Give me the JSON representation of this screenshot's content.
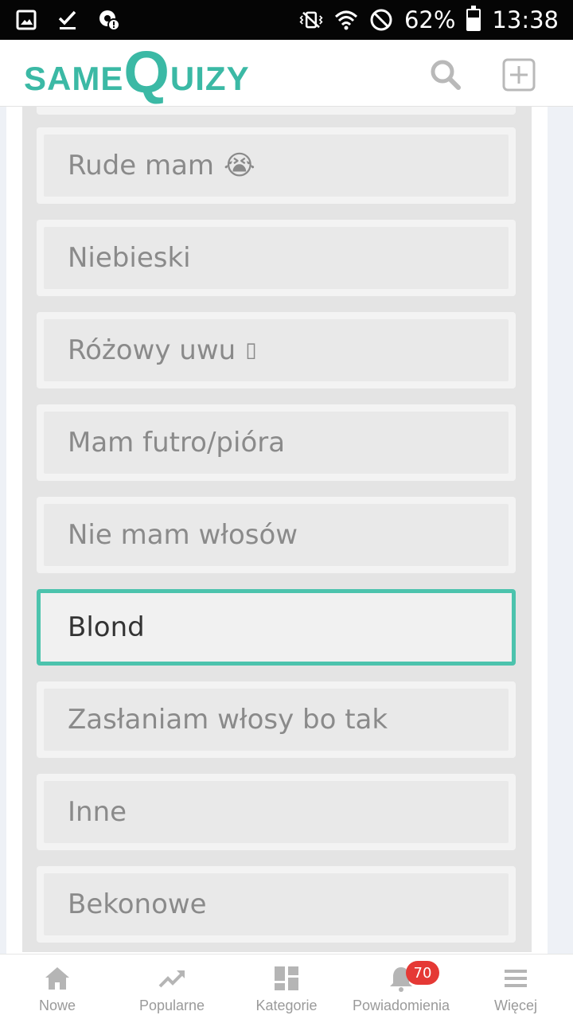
{
  "status_bar": {
    "battery_percent": "62%",
    "battery_level": 0.62,
    "time": "13:38",
    "icons": [
      "image-icon",
      "check-icon",
      "settings-alert-icon",
      "vibrate-icon",
      "wifi-icon",
      "do-not-disturb-icon",
      "battery-icon"
    ]
  },
  "header": {
    "logo_same": "SAME",
    "logo_q": "Q",
    "logo_rest": "UIZY",
    "search_icon": "search-icon",
    "add_icon": "add-icon",
    "brand_color": "#3bb9a5"
  },
  "answers": [
    {
      "label": "Rude mam",
      "emoji": "😭",
      "selected": false
    },
    {
      "label": "Niebieski",
      "emoji": "",
      "selected": false
    },
    {
      "label": "Różowy uwu",
      "emoji": "▯",
      "selected": false
    },
    {
      "label": "Mam futro/pióra",
      "emoji": "",
      "selected": false
    },
    {
      "label": "Nie mam włosów",
      "emoji": "",
      "selected": false
    },
    {
      "label": "Blond",
      "emoji": "",
      "selected": true
    },
    {
      "label": "Zasłaniam włosy bo tak",
      "emoji": "",
      "selected": false
    },
    {
      "label": "Inne",
      "emoji": "",
      "selected": false
    },
    {
      "label": "Bekonowe",
      "emoji": "",
      "selected": false
    }
  ],
  "selected_color": "#4cc3ad",
  "bottom_nav": {
    "items": [
      {
        "label": "Nowe",
        "icon": "home-icon"
      },
      {
        "label": "Popularne",
        "icon": "trending-icon"
      },
      {
        "label": "Kategorie",
        "icon": "dashboard-icon"
      },
      {
        "label": "Powiadomienia",
        "icon": "bell-icon",
        "badge": "70"
      },
      {
        "label": "Więcej",
        "icon": "menu-icon"
      }
    ]
  }
}
